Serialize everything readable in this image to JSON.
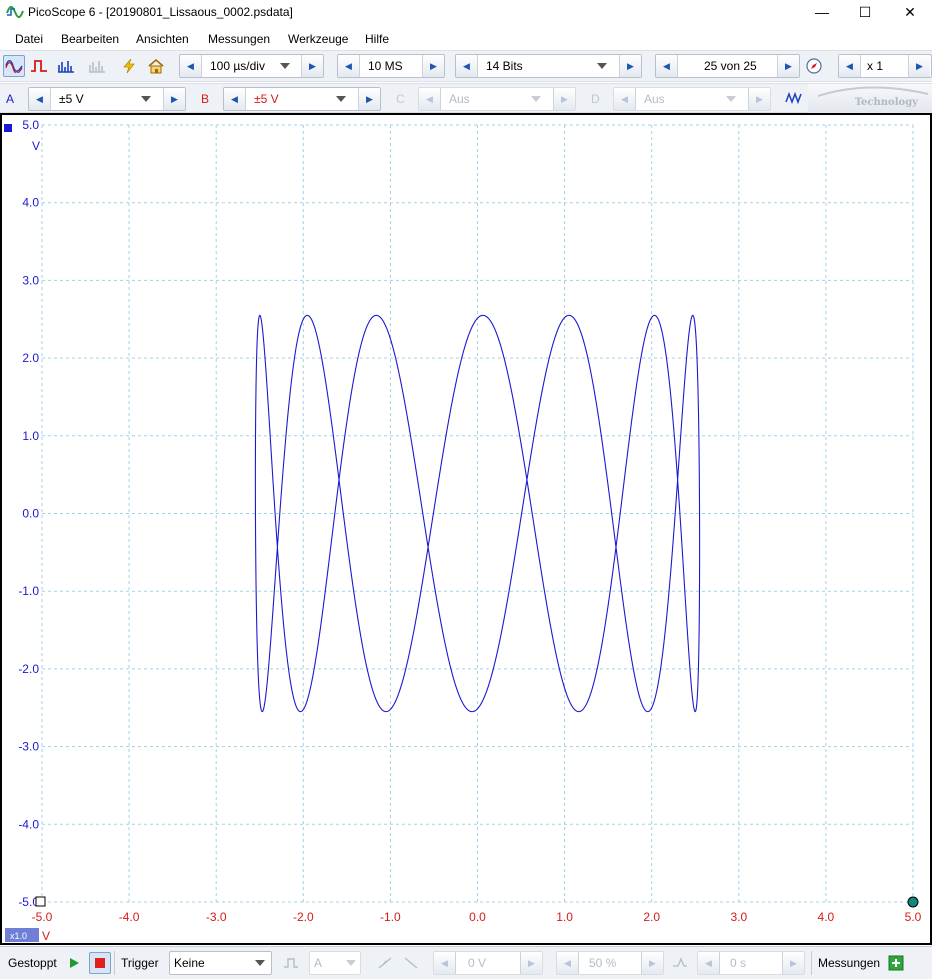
{
  "window": {
    "title": "PicoScope 6 - [20190801_Lissaous_0002.psdata]",
    "minimize_glyph": "—",
    "maximize_glyph": "☐",
    "close_glyph": "✕"
  },
  "menu": [
    "Datei",
    "Bearbeiten",
    "Ansichten",
    "Messungen",
    "Werkzeuge",
    "Hilfe"
  ],
  "toolbar": {
    "icons": [
      "scope-mode-icon",
      "persistence-mode-icon",
      "spectrum-mode-icon",
      "spectrum-disabled-icon",
      "auto-setup-icon",
      "home-icon"
    ],
    "timebase": "100 µs/div",
    "samples": "10 MS",
    "resolution": "14 Bits",
    "buffer": "25 von 25",
    "zoom": "x 1"
  },
  "channels": [
    {
      "letter": "A",
      "range": "±5 V",
      "enabled": true,
      "color": "#1a1ad0"
    },
    {
      "letter": "B",
      "range": "±5 V",
      "enabled": true,
      "color": "#d41c1c"
    },
    {
      "letter": "C",
      "range": "Aus",
      "enabled": false,
      "color": "#c3c8cf"
    },
    {
      "letter": "D",
      "range": "Aus",
      "enabled": false,
      "color": "#c3c8cf"
    }
  ],
  "logo_text": "Technology",
  "plot": {
    "y_unit": "V",
    "x_unit": "V",
    "x_scale_badge": "x1.0",
    "y_ticks": [
      "5.0",
      "4.0",
      "3.0",
      "2.0",
      "1.0",
      "0.0",
      "-1.0",
      "-2.0",
      "-3.0",
      "-4.0",
      "-5.0"
    ],
    "x_ticks": [
      "-5.0",
      "-4.0",
      "-3.0",
      "-2.0",
      "-1.0",
      "0.0",
      "1.0",
      "2.0",
      "3.0",
      "4.0",
      "5.0"
    ],
    "y_axis_color": "#1a1ad0",
    "x_axis_color": "#d41c1c",
    "grid_color": "#9fd3e8"
  },
  "chart_data": {
    "type": "line",
    "title": "",
    "xlabel": "V",
    "ylabel": "V",
    "xlim": [
      -5,
      5
    ],
    "ylim": [
      -5,
      5
    ],
    "grid": true,
    "series": [
      {
        "color": "#1a1ad0",
        "x_amplitude": 2.55,
        "y_amplitude": 2.55,
        "frequency_ratio": "1:7",
        "phase_offset_rad": 0.2
      }
    ]
  },
  "status": {
    "state": "Gestoppt",
    "trigger_label": "Trigger",
    "trigger_mode": "Keine",
    "trigger_source": "A",
    "trigger_level": "0 V",
    "pre_trigger": "50 %",
    "delay": "0 s",
    "measurements": "Messungen"
  }
}
